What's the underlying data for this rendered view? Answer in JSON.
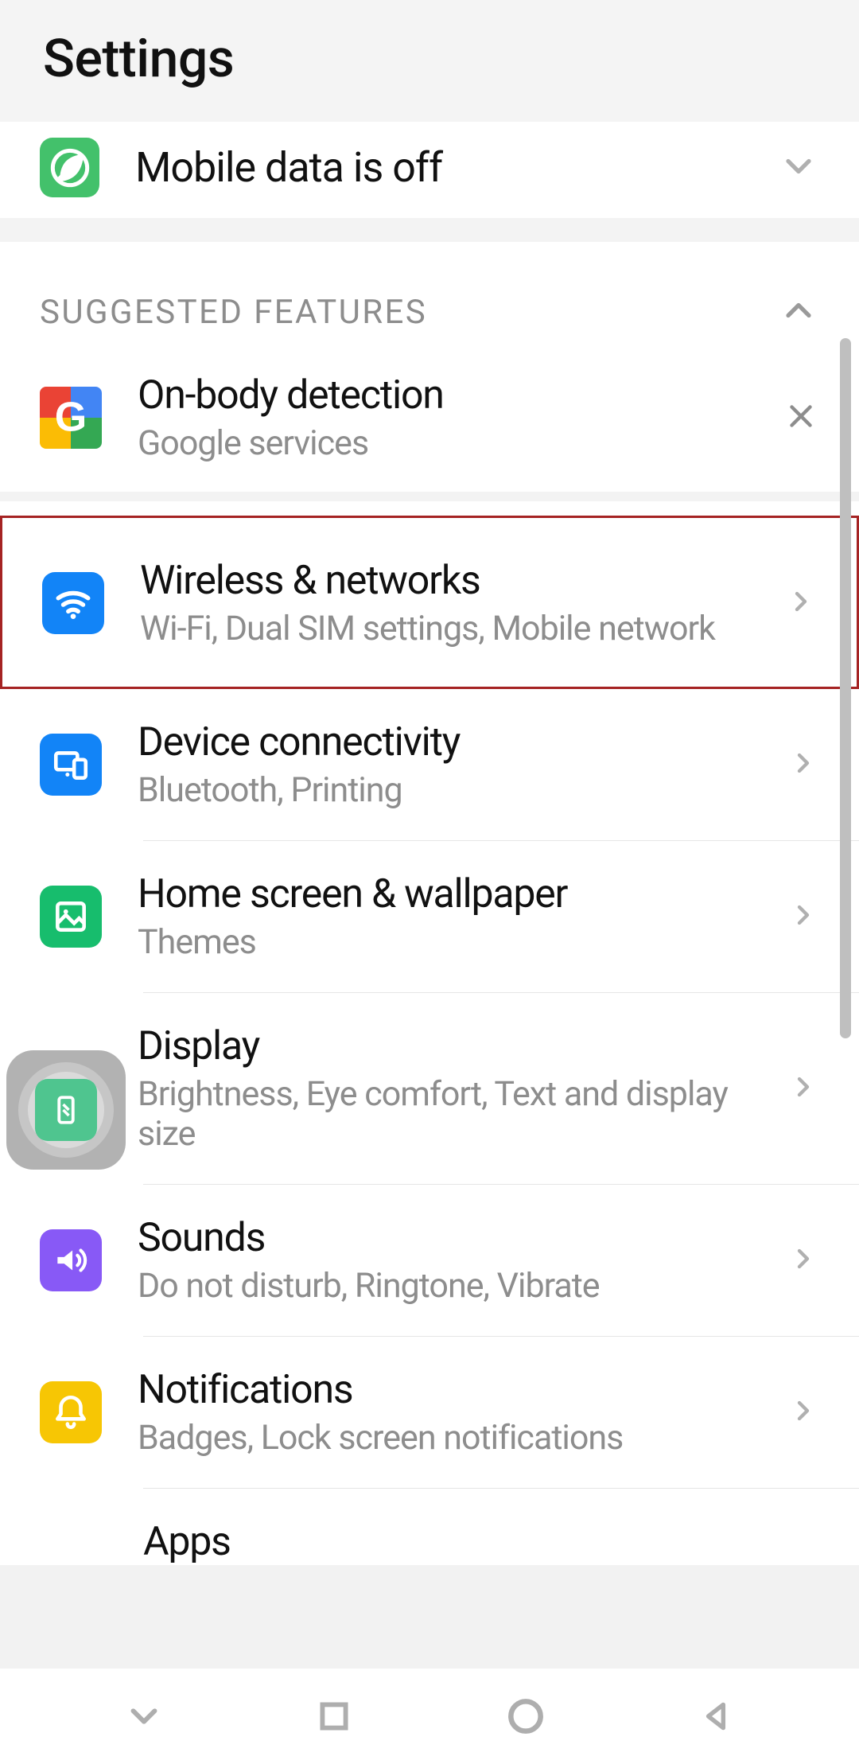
{
  "header": {
    "title": "Settings"
  },
  "banner": {
    "text": "Mobile data is off"
  },
  "suggested": {
    "section_title": "SUGGESTED FEATURES",
    "item": {
      "title": "On-body detection",
      "subtitle": "Google services"
    }
  },
  "items": [
    {
      "title": "Wireless & networks",
      "subtitle": "Wi-Fi, Dual SIM settings, Mobile network",
      "highlighted": true
    },
    {
      "title": "Device connectivity",
      "subtitle": "Bluetooth, Printing"
    },
    {
      "title": "Home screen & wallpaper",
      "subtitle": "Themes"
    },
    {
      "title": "Display",
      "subtitle": "Brightness, Eye comfort, Text and display size"
    },
    {
      "title": "Sounds",
      "subtitle": "Do not disturb, Ringtone, Vibrate"
    },
    {
      "title": "Notifications",
      "subtitle": "Badges, Lock screen notifications"
    }
  ],
  "partial_item": {
    "title": "Apps"
  }
}
